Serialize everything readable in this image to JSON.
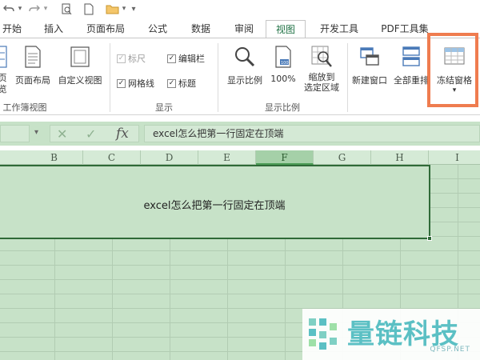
{
  "tabs": [
    "开始",
    "插入",
    "页面布局",
    "公式",
    "数据",
    "审阅",
    "视图",
    "开发工具",
    "PDF工具集"
  ],
  "active_tab": "视图",
  "ribbon": {
    "workbook_views": {
      "items": [
        "页\n览",
        "页面布局",
        "自定义视图"
      ],
      "label": "工作簿视图"
    },
    "show": {
      "checkboxes": [
        {
          "label": "标尺",
          "checked": true,
          "disabled": true
        },
        {
          "label": "编辑栏",
          "checked": true,
          "disabled": false
        },
        {
          "label": "网格线",
          "checked": true,
          "disabled": false
        },
        {
          "label": "标题",
          "checked": true,
          "disabled": false
        }
      ],
      "label": "显示"
    },
    "zoom": {
      "items": [
        "显示比例",
        "100%",
        "缩放到\n选定区域"
      ],
      "label": "显示比例"
    },
    "window": {
      "items": [
        "新建窗口",
        "全部重排",
        "冻结窗格"
      ],
      "dropdown_glyph": "▾"
    }
  },
  "formula_bar": {
    "name_box_dropdown": "▾",
    "cancel": "✕",
    "enter": "✓",
    "fx": "fx",
    "formula": "excel怎么把第一行固定在顶端"
  },
  "columns": [
    "B",
    "C",
    "D",
    "E",
    "F",
    "G",
    "H",
    "I"
  ],
  "selected_column": "F",
  "cell_text": "excel怎么把第一行固定在顶端",
  "watermark": {
    "title": "量链科技",
    "sub": "QFSP.NET"
  },
  "colors": {
    "accent": "#217346",
    "highlight_box": "#ef7c4f",
    "sheet_bg": "#c7e2c8"
  }
}
